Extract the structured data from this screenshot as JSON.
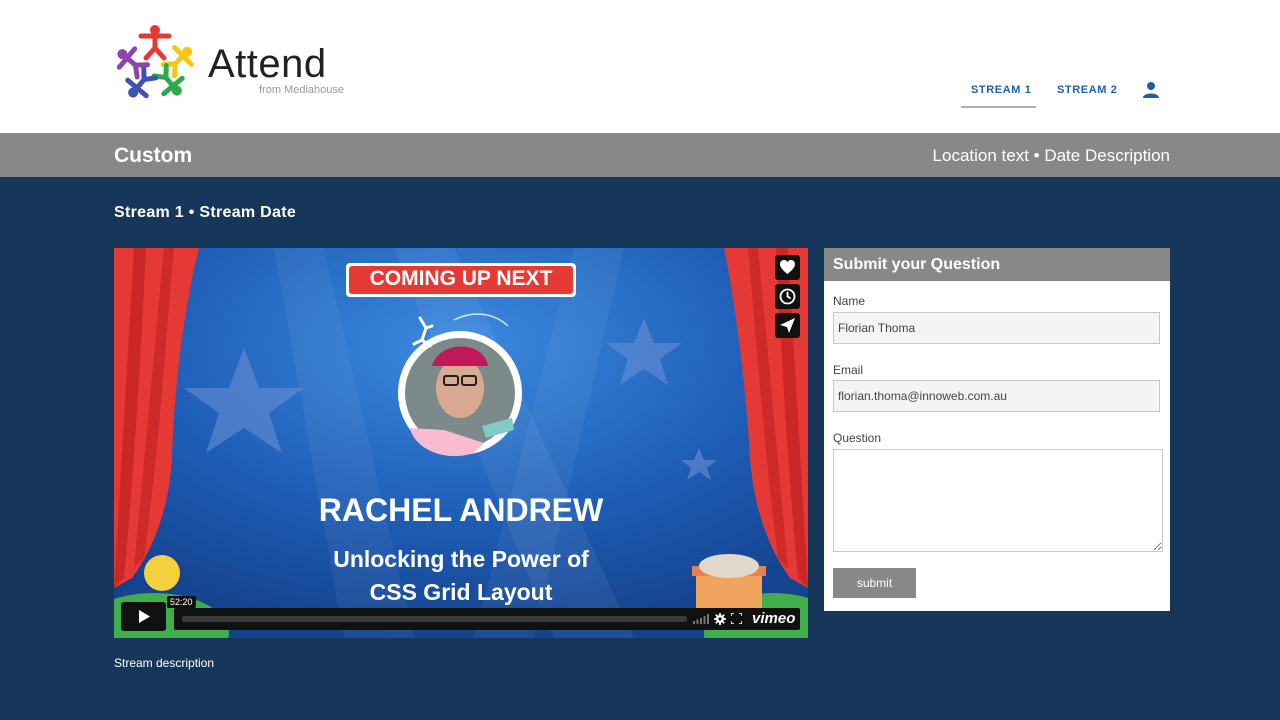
{
  "header": {
    "logo_title": "Attend",
    "logo_subtitle": "from Mediahouse",
    "nav": [
      {
        "label": "STREAM 1",
        "active": true
      },
      {
        "label": "STREAM 2",
        "active": false
      }
    ],
    "user_icon": "user-icon"
  },
  "titlebar": {
    "title": "Custom",
    "meta": "Location text • Date Description"
  },
  "main": {
    "stream_heading": "Stream 1 • Stream Date",
    "stream_description": "Stream description",
    "video": {
      "banner": "COMING UP NEXT",
      "speaker": "RACHEL ANDREW",
      "talk_line1": "Unlocking the Power of",
      "talk_line2": "CSS Grid Layout",
      "duration": "52:20",
      "player_brand": "vimeo",
      "side_icons": [
        "heart-icon",
        "clock-icon",
        "send-icon"
      ]
    }
  },
  "question_form": {
    "title": "Submit your Question",
    "name_label": "Name",
    "name_value": "Florian Thoma",
    "email_label": "Email",
    "email_value": "florian.thoma@innoweb.com.au",
    "question_label": "Question",
    "question_value": "",
    "submit_label": "submit"
  },
  "colors": {
    "page_bg": "#17375a",
    "bar_grey": "#888888",
    "nav_blue": "#1f5fa8"
  }
}
